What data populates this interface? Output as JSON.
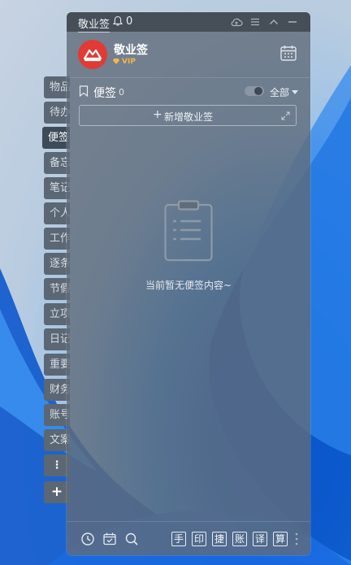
{
  "app": {
    "title": "敬业签",
    "bell_count": "0"
  },
  "side_tabs": {
    "items": [
      {
        "label": "物品"
      },
      {
        "label": "待办"
      },
      {
        "label": "便签"
      },
      {
        "label": "备忘"
      },
      {
        "label": "笔记"
      },
      {
        "label": "个人"
      },
      {
        "label": "工作"
      },
      {
        "label": "逐条"
      },
      {
        "label": "节假"
      },
      {
        "label": "立项"
      },
      {
        "label": "日记"
      },
      {
        "label": "重要"
      },
      {
        "label": "财务"
      },
      {
        "label": "账号"
      },
      {
        "label": "文案"
      }
    ],
    "more_label": "⋮",
    "add_label": "+"
  },
  "profile": {
    "name": "敬业签",
    "badge": "VIP"
  },
  "section": {
    "title": "便签",
    "count": "0",
    "filter": "全部"
  },
  "add_button": {
    "plus": "+",
    "label": "新增敬业签"
  },
  "empty": {
    "text": "当前暂无便签内容~"
  },
  "toolbar": {
    "tools": [
      {
        "label": "手"
      },
      {
        "label": "印"
      },
      {
        "label": "捷"
      },
      {
        "label": "账"
      },
      {
        "label": "译"
      },
      {
        "label": "算"
      }
    ]
  },
  "colors": {
    "panel": "#606c79",
    "active_tab": "#3d4a58",
    "avatar": "#e23a35",
    "vip": "#f3b64a"
  }
}
